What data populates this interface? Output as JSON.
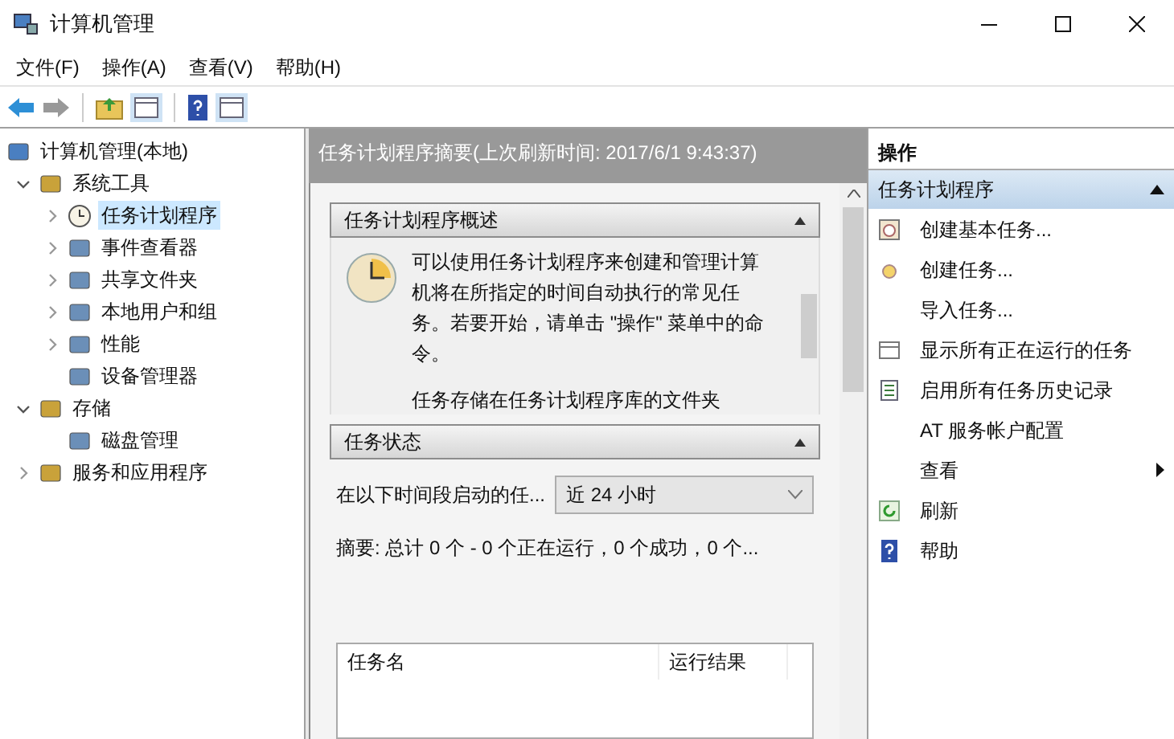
{
  "window": {
    "title": "计算机管理"
  },
  "menu": [
    "文件(F)",
    "操作(A)",
    "查看(V)",
    "帮助(H)"
  ],
  "tree": [
    {
      "label": "计算机管理(本地)",
      "children": [
        {
          "label": "系统工具",
          "expanded": true,
          "selected": false,
          "children": [
            {
              "label": "任务计划程序",
              "expanded": false,
              "selected": true
            },
            {
              "label": "事件查看器",
              "expanded": false,
              "selected": false
            },
            {
              "label": "共享文件夹",
              "expanded": false,
              "selected": false
            },
            {
              "label": "本地用户和组",
              "expanded": false,
              "selected": false
            },
            {
              "label": "性能",
              "expanded": false,
              "selected": false
            },
            {
              "label": "设备管理器",
              "selected": false
            }
          ]
        },
        {
          "label": "存储",
          "expanded": true,
          "selected": false,
          "children": [
            {
              "label": "磁盘管理",
              "selected": false
            }
          ]
        },
        {
          "label": "服务和应用程序",
          "expanded": false,
          "selected": false
        }
      ]
    }
  ],
  "summary_header": "任务计划程序摘要(上次刷新时间: 2017/6/1 9:43:37)",
  "overview": {
    "title": "任务计划程序概述",
    "expanded": true,
    "text": "可以使用任务计划程序来创建和管理计算机将在所指定的时间自动执行的常见任务。若要开始，请单击 \"操作\" 菜单中的命令。",
    "text_2": "任务存储在任务计划程序库的文件夹"
  },
  "status": {
    "title": "任务状态",
    "expanded": true,
    "period_label": "在以下时间段启动的任...",
    "period_value": "近 24 小时",
    "summary": "摘要: 总计 0 个 - 0 个正在运行，0 个成功，0 个...",
    "columns": [
      "任务名",
      "运行结果"
    ]
  },
  "actions": {
    "title": "操作",
    "group": "任务计划程序",
    "expanded": true,
    "items": [
      {
        "label": "创建基本任务...",
        "kind": "action"
      },
      {
        "label": "创建任务...",
        "kind": "action"
      },
      {
        "label": "导入任务...",
        "kind": "action"
      },
      {
        "label": "显示所有正在运行的任务",
        "kind": "action"
      },
      {
        "label": "启用所有任务历史记录",
        "kind": "action"
      },
      {
        "label": "AT 服务帐户配置",
        "kind": "action"
      },
      {
        "label": "查看",
        "kind": "submenu"
      },
      {
        "label": "刷新",
        "kind": "action"
      },
      {
        "label": "帮助",
        "kind": "action"
      }
    ]
  }
}
